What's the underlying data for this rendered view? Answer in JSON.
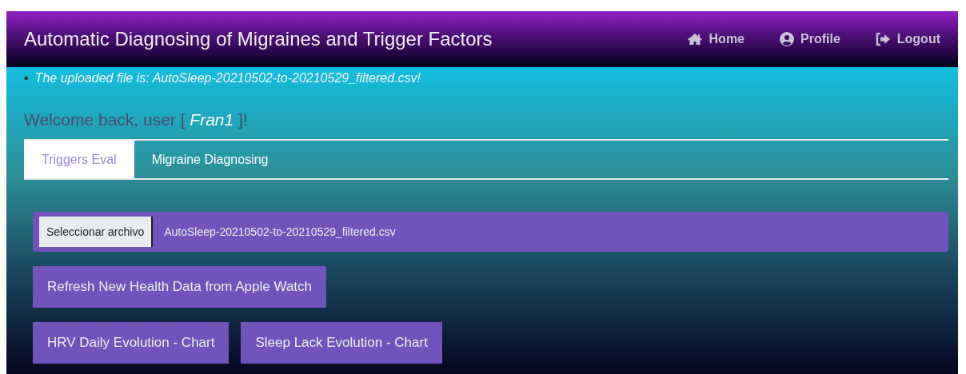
{
  "navbar": {
    "title": "Automatic Diagnosing of Migraines and Trigger Factors",
    "links": [
      {
        "kind": "home",
        "label": "Home"
      },
      {
        "kind": "user",
        "label": "Profile"
      },
      {
        "kind": "logout",
        "label": "Logout"
      }
    ]
  },
  "messages": [
    {
      "bullet": "•",
      "text": "The uploaded file is: AutoSleep-20210502-to-20210529_filtered.csv!"
    }
  ],
  "welcome": "Welcome back, user [ *Fran1* ]!",
  "tabs": [
    {
      "label": "Triggers Eval",
      "selected": true
    },
    {
      "label": "Migraine Diagnosing",
      "selected": false
    }
  ],
  "file_input": {
    "button": "Seleccionar archivo",
    "value": "AutoSleep-20210502-to-20210529_filtered.csv"
  },
  "button_rows": [
    [
      "Refresh New Health Data from Apple Watch"
    ],
    [
      "HRV Daily Evolution - Chart",
      "Sleep Lack Evolution - Chart"
    ]
  ]
}
